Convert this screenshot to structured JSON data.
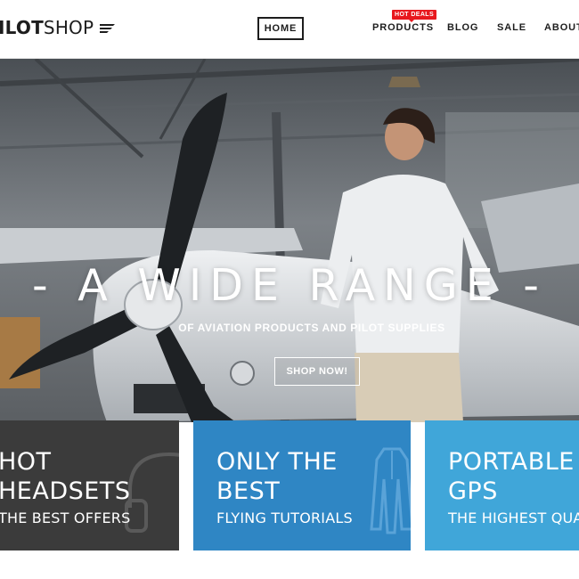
{
  "brand": {
    "logo_bold": "ILOT",
    "logo_light": "SHOP",
    "logo_icon": "wings-icon"
  },
  "nav": {
    "home": "HOME",
    "products": "PRODUCTS",
    "products_badge": "HOT DEALS",
    "blog": "BLOG",
    "sale": "SALE",
    "about": "ABOUT"
  },
  "hero": {
    "title": "- A WIDE RANGE -",
    "subtitle": "OF AVIATION PRODUCTS AND PILOT SUPPLIES",
    "cta": "SHOP NOW!"
  },
  "features": [
    {
      "title_line1": "HOT",
      "title_line2": "HEADSETS",
      "subtitle": "THE BEST OFFERS",
      "icon": "headset-icon",
      "color": "#3b3b3b"
    },
    {
      "title_line1": "ONLY THE",
      "title_line2": "BEST",
      "subtitle": "FLYING TUTORIALS",
      "icon": "pilot-jacket-icon",
      "color": "#2f86c4"
    },
    {
      "title_line1": "PORTABLE",
      "title_line2": "GPS",
      "subtitle": "THE HIGHEST QUA",
      "icon": "gps-icon",
      "color": "#40a6d9"
    }
  ],
  "colors": {
    "text_dark": "#1d1d1d",
    "badge_red": "#e8181e",
    "box_dark": "#3b3b3b",
    "box_blue": "#2f86c4",
    "box_light_blue": "#40a6d9"
  }
}
